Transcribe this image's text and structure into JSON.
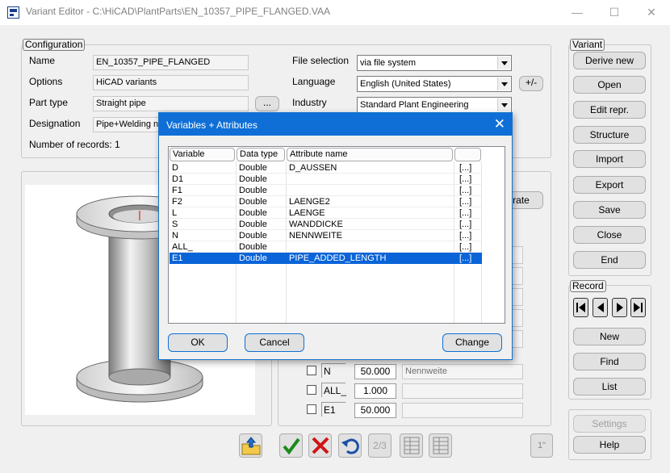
{
  "window": {
    "title": "Variant Editor - C:\\HiCAD\\PlantParts\\EN_10357_PIPE_FLANGED.VAA",
    "minimize": "—",
    "maximize": "☐",
    "close": "✕"
  },
  "configuration": {
    "group_label": "Configuration",
    "name_label": "Name",
    "name_value": "EN_10357_PIPE_FLANGED",
    "options_label": "Options",
    "options_value": "HiCAD variants",
    "part_type_label": "Part type",
    "part_type_value": "Straight pipe",
    "browse_label": "...",
    "designation_label": "Designation",
    "designation_value": "Pipe+Welding n",
    "records": "Number of records: 1",
    "file_selection_label": "File selection",
    "file_selection_value": "via file system",
    "language_label": "Language",
    "language_value": "English (United States)",
    "plus_minus_label": "+/-",
    "industry_label": "Industry",
    "industry_value": "Standard Plant Engineering"
  },
  "hidden_button_partial": "rate",
  "variant_group": {
    "label": "Variant",
    "buttons": [
      "Derive new",
      "Open",
      "Edit repr.",
      "Structure",
      "Import",
      "Export",
      "Save",
      "Close",
      "End"
    ]
  },
  "record_group": {
    "label": "Record",
    "buttons": [
      "New",
      "Find",
      "List"
    ]
  },
  "bottom_right": {
    "settings": "Settings",
    "help": "Help"
  },
  "variables_panel": {
    "rows": [
      {
        "name": "N",
        "value": "50.000",
        "desc": "Nennweite"
      },
      {
        "name": "ALL_",
        "value": "1.000",
        "desc": ""
      },
      {
        "name": "E1",
        "value": "50.000",
        "desc": ""
      }
    ]
  },
  "toolbar": {
    "page_indicator": "2/3",
    "inch_label": "1\""
  },
  "dialog": {
    "title": "Variables + Attributes",
    "close": "✕",
    "columns": [
      "Variable",
      "Data type",
      "Attribute name",
      ""
    ],
    "rows": [
      {
        "variable": "D",
        "type": "Double",
        "attribute": "D_AUSSEN",
        "action": "[...]"
      },
      {
        "variable": "D1",
        "type": "Double",
        "attribute": "",
        "action": "[...]"
      },
      {
        "variable": "F1",
        "type": "Double",
        "attribute": "",
        "action": "[...]"
      },
      {
        "variable": "F2",
        "type": "Double",
        "attribute": "LAENGE2",
        "action": "[...]"
      },
      {
        "variable": "L",
        "type": "Double",
        "attribute": "LAENGE",
        "action": "[...]"
      },
      {
        "variable": "S",
        "type": "Double",
        "attribute": "WANDDICKE",
        "action": "[...]"
      },
      {
        "variable": "N",
        "type": "Double",
        "attribute": "NENNWEITE",
        "action": "[...]"
      },
      {
        "variable": "ALL_",
        "type": "Double",
        "attribute": "",
        "action": "[...]"
      },
      {
        "variable": "E1",
        "type": "Double",
        "attribute": "PIPE_ADDED_LENGTH",
        "action": "[...]"
      }
    ],
    "selected_row": 8,
    "ok": "OK",
    "cancel": "Cancel",
    "change": "Change"
  }
}
